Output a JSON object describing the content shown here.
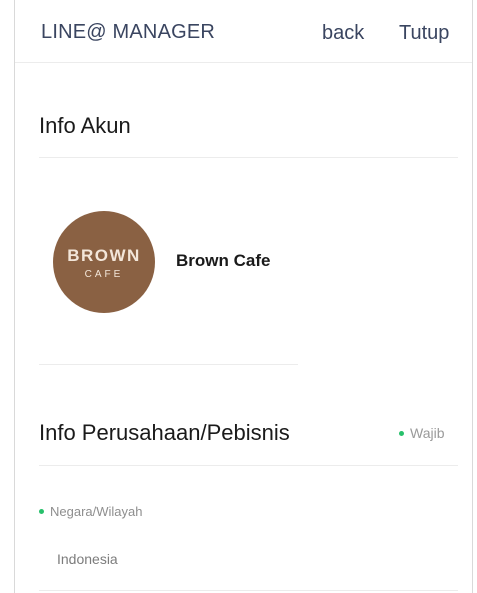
{
  "header": {
    "brand": "LINE@ MANAGER",
    "back_label": "back",
    "close_label": "Tutup"
  },
  "account_section": {
    "title": "Info Akun",
    "avatar_line1": "BROWN",
    "avatar_line2": "CAFE",
    "account_name": "Brown Cafe"
  },
  "business_section": {
    "title": "Info Perusahaan/Pebisnis",
    "required_label": "Wajib",
    "field_label": "Negara/Wilayah",
    "field_value": "Indonesia"
  },
  "colors": {
    "accent_dot": "#27c06b",
    "avatar_bg": "#8a6143",
    "header_text": "#3a4560"
  }
}
